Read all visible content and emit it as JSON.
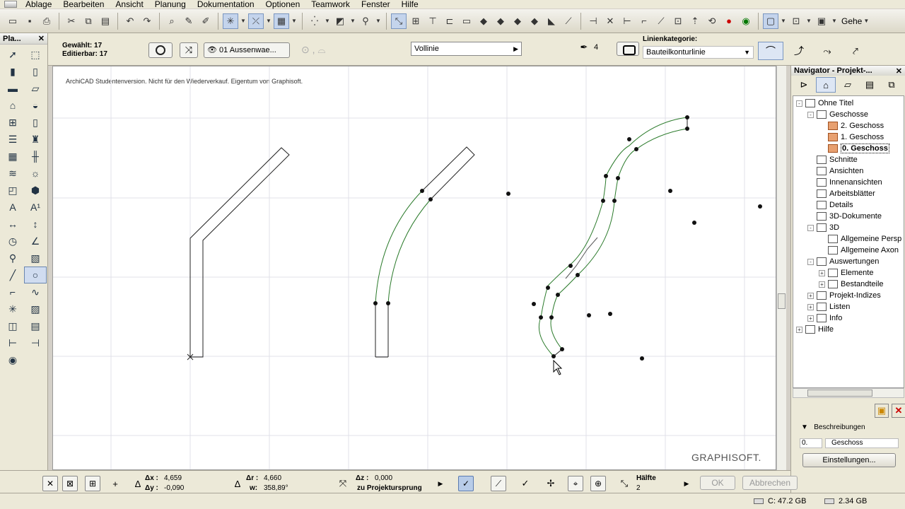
{
  "menu": [
    "Ablage",
    "Bearbeiten",
    "Ansicht",
    "Planung",
    "Dokumentation",
    "Optionen",
    "Teamwork",
    "Fenster",
    "Hilfe"
  ],
  "toolbar": {
    "geschoss_label": "Gehe",
    "icons": [
      "new-file-icon",
      "save-icon",
      "print-icon",
      "cut-icon",
      "copy-icon",
      "paste-icon",
      "undo-icon",
      "redo-icon",
      "find-icon",
      "eyedropper-icon",
      "syringe-icon",
      "snap-icon",
      "guide-icon",
      "grid-icon",
      "cursor-snap-icon",
      "walls-icon",
      "layer-icon",
      "3d-icon",
      "drag-icon",
      "rotate-icon",
      "mirror-icon",
      "elevate-icon",
      "multiply-icon",
      "resize-icon",
      "split-icon",
      "adjust-icon",
      "intersect-icon",
      "fillet-icon",
      "offset-icon",
      "trace-icon",
      "color-icon"
    ]
  },
  "toolbox": {
    "title": "Pla...",
    "tools": [
      "arrow-icon",
      "marquee-icon",
      "wall-icon",
      "column-icon",
      "beam-icon",
      "slab-icon",
      "roof-icon",
      "shell-icon",
      "window-icon",
      "door-icon",
      "stair-icon",
      "object-icon",
      "curtain-wall-icon",
      "railing-icon",
      "mesh-icon",
      "lamp-icon",
      "zone-icon",
      "morph-icon",
      "text-icon",
      "label-icon",
      "dimension-icon",
      "level-dimension-icon",
      "radial-dimension-icon",
      "angle-dimension-icon",
      "spot-icon",
      "fill-icon",
      "line-icon",
      "circle-icon",
      "polyline-icon",
      "spline-icon",
      "hotspot-icon",
      "figure-icon",
      "detail-icon",
      "worksheet-icon",
      "section-icon",
      "elevation-icon",
      "camera-icon"
    ]
  },
  "infobox": {
    "selected": "Gewählt: 17",
    "editable": "Editierbar: 17",
    "layer": "01 Aussenwae...",
    "linetype": "Vollinie",
    "pen_number": "4",
    "line_category_label": "Linienkategorie:",
    "line_category": "Bauteilkonturlinie"
  },
  "canvas": {
    "watermark": "ArchiCAD Studentenversion. Nicht für den Wiederverkauf. Eigentum von Graphisoft.",
    "brand": "GRAPHISOFT."
  },
  "navigator": {
    "title": "Navigator - Projekt-...",
    "tree": [
      {
        "label": "Ohne Titel",
        "level": 0,
        "expander": "-"
      },
      {
        "label": "Geschosse",
        "level": 1,
        "expander": "-"
      },
      {
        "label": "2. Geschoss",
        "level": 2,
        "expander": ""
      },
      {
        "label": "1. Geschoss",
        "level": 2,
        "expander": ""
      },
      {
        "label": "0. Geschoss",
        "level": 2,
        "expander": "",
        "current": true
      },
      {
        "label": "Schnitte",
        "level": 1,
        "expander": ""
      },
      {
        "label": "Ansichten",
        "level": 1,
        "expander": ""
      },
      {
        "label": "Innenansichten",
        "level": 1,
        "expander": ""
      },
      {
        "label": "Arbeitsblätter",
        "level": 1,
        "expander": ""
      },
      {
        "label": "Details",
        "level": 1,
        "expander": ""
      },
      {
        "label": "3D-Dokumente",
        "level": 1,
        "expander": ""
      },
      {
        "label": "3D",
        "level": 1,
        "expander": "-"
      },
      {
        "label": "Allgemeine Persp",
        "level": 2,
        "expander": ""
      },
      {
        "label": "Allgemeine Axon",
        "level": 2,
        "expander": ""
      },
      {
        "label": "Auswertungen",
        "level": 1,
        "expander": "-"
      },
      {
        "label": "Elemente",
        "level": 2,
        "expander": "+"
      },
      {
        "label": "Bestandteile",
        "level": 2,
        "expander": "+"
      },
      {
        "label": "Projekt-Indizes",
        "level": 1,
        "expander": "+"
      },
      {
        "label": "Listen",
        "level": 1,
        "expander": "+"
      },
      {
        "label": "Info",
        "level": 1,
        "expander": "+"
      },
      {
        "label": "Hilfe",
        "level": 0,
        "expander": "+"
      }
    ],
    "descriptions_label": "Beschreibungen",
    "desc_number": "0.",
    "desc_name": "Geschoss",
    "settings_label": "Einstellungen..."
  },
  "controlbox": {
    "dx_label": "Δx :",
    "dx": "4,659",
    "dy_label": "Δy :",
    "dy": "-0,090",
    "dr_label": "Δr :",
    "dr": "4,660",
    "w_label": "w:",
    "w": "358,89°",
    "dz_label": "Δz :",
    "dz": "0,000",
    "zu_label": "zu Projektursprung",
    "haelfte_label": "Hälfte",
    "haelfte_value": "2",
    "ok": "OK",
    "cancel": "Abbrechen"
  },
  "status": {
    "c_drive": "C: 47.2 GB",
    "ram": "2.34 GB"
  }
}
